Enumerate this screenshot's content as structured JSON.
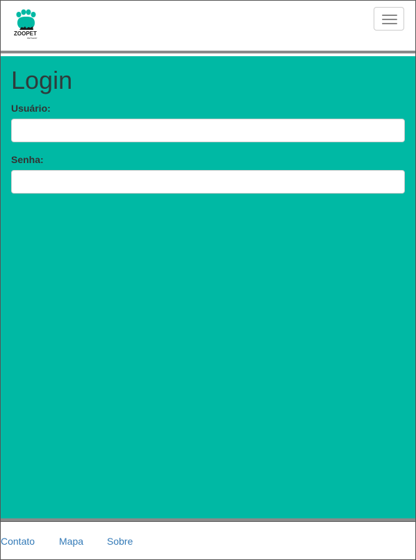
{
  "header": {
    "logo_text": "ZOOPET",
    "logo_subtext": "PETSHOP",
    "brand_color": "#00b9a4",
    "menu_icon": "hamburger-menu-icon"
  },
  "login": {
    "title": "Login",
    "username_label": "Usuário:",
    "username_value": "",
    "password_label": "Senha:",
    "password_value": ""
  },
  "footer": {
    "links": [
      "Contato",
      "Mapa",
      "Sobre"
    ],
    "link_color": "#337ab7"
  }
}
